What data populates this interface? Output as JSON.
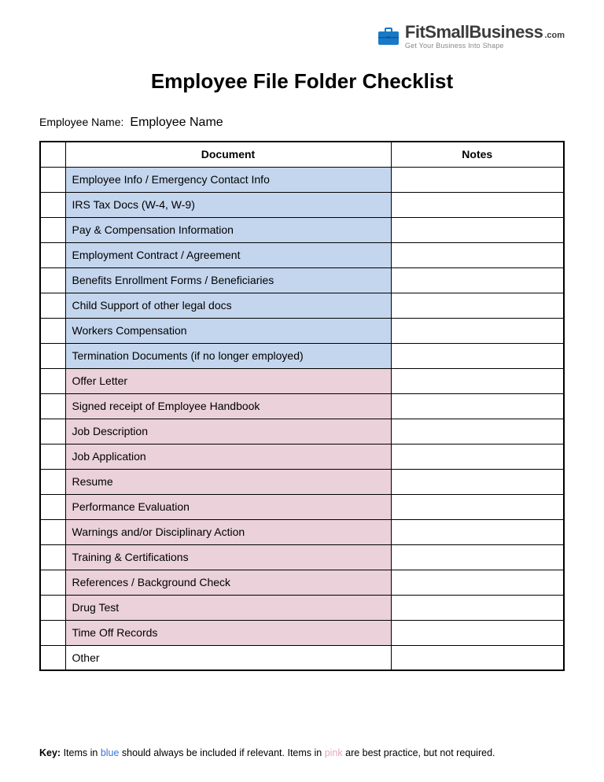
{
  "logo": {
    "main": "FitSmallBusiness",
    "dotcom": ".com",
    "tagline": "Get Your Business Into Shape"
  },
  "title": "Employee File Folder Checklist",
  "employee_name_label": "Employee Name:",
  "employee_name_value": "Employee Name",
  "headers": {
    "document": "Document",
    "notes": "Notes"
  },
  "rows": [
    {
      "doc": "Employee Info / Emergency Contact Info",
      "cat": "blue"
    },
    {
      "doc": "IRS Tax Docs (W-4, W-9)",
      "cat": "blue"
    },
    {
      "doc": "Pay & Compensation Information",
      "cat": "blue"
    },
    {
      "doc": "Employment Contract / Agreement",
      "cat": "blue"
    },
    {
      "doc": "Benefits Enrollment Forms / Beneficiaries",
      "cat": "blue"
    },
    {
      "doc": "Child Support of other legal docs",
      "cat": "blue"
    },
    {
      "doc": "Workers Compensation",
      "cat": "blue"
    },
    {
      "doc": "Termination Documents (if no longer employed)",
      "cat": "blue"
    },
    {
      "doc": "Offer Letter",
      "cat": "pink"
    },
    {
      "doc": "Signed receipt of Employee Handbook",
      "cat": "pink"
    },
    {
      "doc": "Job Description",
      "cat": "pink"
    },
    {
      "doc": "Job Application",
      "cat": "pink"
    },
    {
      "doc": "Resume",
      "cat": "pink"
    },
    {
      "doc": "Performance Evaluation",
      "cat": "pink"
    },
    {
      "doc": "Warnings and/or Disciplinary Action",
      "cat": "pink"
    },
    {
      "doc": "Training & Certifications",
      "cat": "pink"
    },
    {
      "doc": "References / Background Check",
      "cat": "pink"
    },
    {
      "doc": "Drug Test",
      "cat": "pink"
    },
    {
      "doc": "Time Off Records",
      "cat": "pink"
    },
    {
      "doc": "Other",
      "cat": "none"
    }
  ],
  "key": {
    "label": "Key:",
    "part1": " Items in ",
    "blue_word": "blue",
    "part2": " should always be included if relevant. Items in ",
    "pink_word": "pink",
    "part3": " are best practice, but not required."
  },
  "colors": {
    "blue_bg": "#c4d6ee",
    "pink_bg": "#ead1da"
  }
}
